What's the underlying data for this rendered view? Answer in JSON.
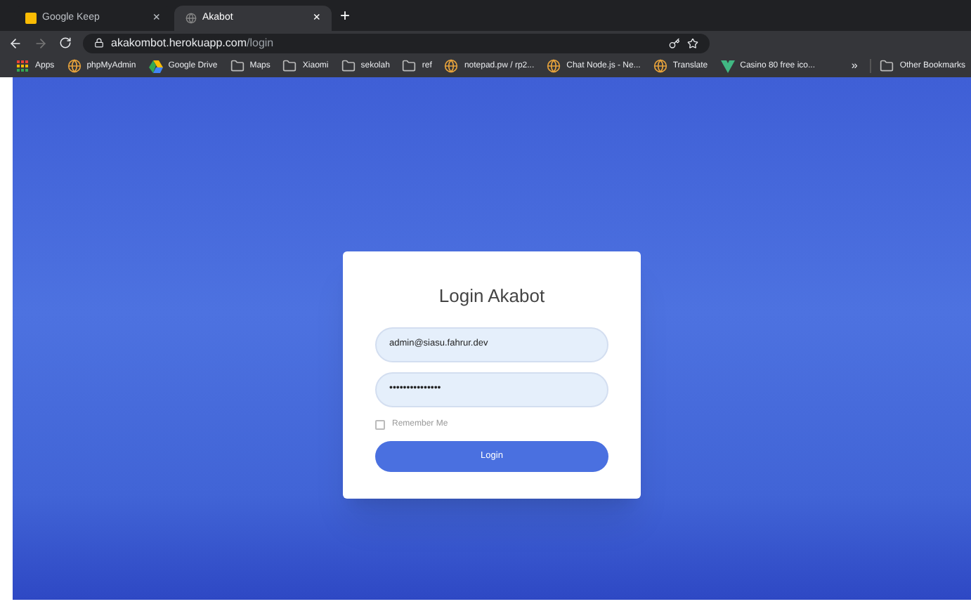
{
  "tabs": [
    {
      "title": "Google Keep",
      "selected": false,
      "close": "×"
    },
    {
      "title": "Akabot",
      "selected": true,
      "close": "×"
    }
  ],
  "new_tab": "+",
  "address": {
    "host": "akakombot.herokuapp.com",
    "path": "/login"
  },
  "bookmarks": [
    {
      "label": "Apps",
      "kind": "apps"
    },
    {
      "label": "phpMyAdmin",
      "kind": "site"
    },
    {
      "label": "Google Drive",
      "kind": "drive"
    },
    {
      "label": "Maps",
      "kind": "folder"
    },
    {
      "label": "Xiaomi",
      "kind": "folder"
    },
    {
      "label": "sekolah",
      "kind": "folder"
    },
    {
      "label": "ref",
      "kind": "folder"
    },
    {
      "label": "notepad.pw / rp2...",
      "kind": "site"
    },
    {
      "label": "Chat Node.js - Ne...",
      "kind": "site"
    },
    {
      "label": "Translate",
      "kind": "site"
    },
    {
      "label": "Casino 80 free ico...",
      "kind": "vue"
    }
  ],
  "more_bookmarks": "»",
  "other_bookmarks": "Other Bookmarks",
  "login": {
    "title": "Login Akabot",
    "email": "admin@siasu.fahrur.dev",
    "password": "•••••••••••••••",
    "remember": {
      "label": "Remember Me",
      "checked": false
    },
    "button": "Login"
  }
}
